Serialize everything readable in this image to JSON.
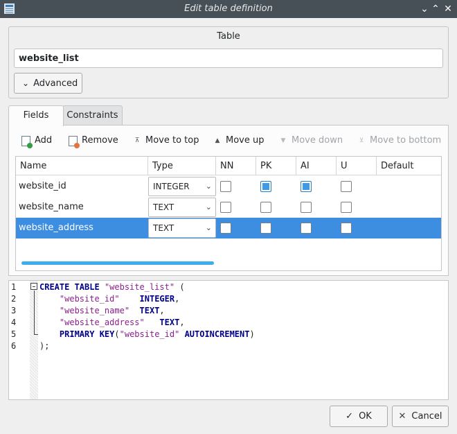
{
  "window": {
    "title": "Edit table definition",
    "icons": [
      "table-icon",
      "minimize-icon",
      "maximize-icon",
      "close-icon"
    ]
  },
  "table_section": {
    "label": "Table",
    "name_value": "website_list",
    "advanced_label": "Advanced"
  },
  "tabs": [
    {
      "label": "Fields",
      "active": true
    },
    {
      "label": "Constraints",
      "active": false
    }
  ],
  "toolbar": {
    "add": "Add",
    "remove": "Remove",
    "move_to_top": "Move to top",
    "move_up": "Move up",
    "move_down": "Move down",
    "move_to_bottom": "Move to bottom"
  },
  "fields_table": {
    "columns": [
      "Name",
      "Type",
      "NN",
      "PK",
      "AI",
      "U",
      "Default"
    ],
    "rows": [
      {
        "name": "website_id",
        "type": "INTEGER",
        "nn": false,
        "pk": true,
        "ai": true,
        "u": false,
        "selected": false
      },
      {
        "name": "website_name",
        "type": "TEXT",
        "nn": false,
        "pk": false,
        "ai": false,
        "u": false,
        "selected": false
      },
      {
        "name": "website_address",
        "type": "TEXT",
        "nn": false,
        "pk": false,
        "ai": false,
        "u": false,
        "selected": true
      }
    ]
  },
  "sql_preview": {
    "line_numbers": [
      "1",
      "2",
      "3",
      "4",
      "5",
      "6"
    ],
    "l1_kw": "CREATE TABLE",
    "l1_str": "\"website_list\"",
    "l1_end": "(",
    "l2_str": "\"website_id\"",
    "l2_kw": "INTEGER",
    "l2_end": ",",
    "l3_str": "\"website_name\"",
    "l3_kw": "TEXT",
    "l3_end": ",",
    "l4_str": "\"website_address\"",
    "l4_kw": "TEXT",
    "l4_end": ",",
    "l5_kw1": "PRIMARY KEY",
    "l5_open": "(",
    "l5_str": "\"website_id\"",
    "l5_kw2": "AUTOINCREMENT",
    "l5_close": ")",
    "l6": ");"
  },
  "buttons": {
    "ok": "OK",
    "cancel": "Cancel"
  },
  "colors": {
    "titlebar": "#475057",
    "selection": "#3d8ee0",
    "keyword": "#00008b",
    "string": "#8b1f8b"
  }
}
